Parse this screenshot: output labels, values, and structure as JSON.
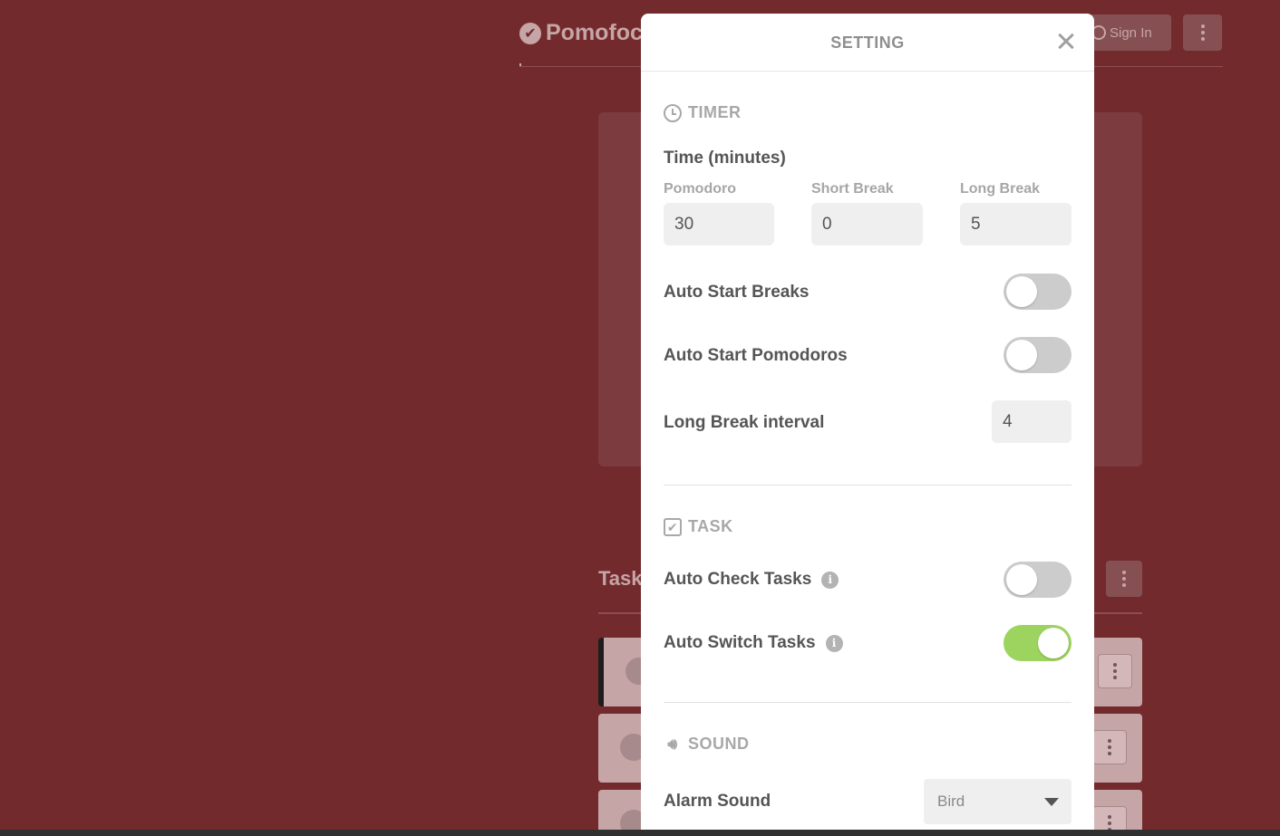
{
  "app": {
    "logo_text": "Pomofoc",
    "signin_label": "Sign In",
    "tasks_title": "Task"
  },
  "modal": {
    "title": "SETTING",
    "timer": {
      "section_label": "TIMER",
      "time_heading": "Time (minutes)",
      "pomodoro_label": "Pomodoro",
      "pomodoro_value": "30",
      "short_break_label": "Short Break",
      "short_break_value": "0",
      "long_break_label": "Long Break",
      "long_break_value": "5",
      "auto_start_breaks_label": "Auto Start Breaks",
      "auto_start_breaks_on": false,
      "auto_start_pomodoros_label": "Auto Start Pomodoros",
      "auto_start_pomodoros_on": false,
      "long_break_interval_label": "Long Break interval",
      "long_break_interval_value": "4"
    },
    "task": {
      "section_label": "TASK",
      "auto_check_label": "Auto Check Tasks",
      "auto_check_on": false,
      "auto_switch_label": "Auto Switch Tasks",
      "auto_switch_on": true
    },
    "sound": {
      "section_label": "SOUND",
      "alarm_label": "Alarm Sound",
      "alarm_value": "Bird"
    }
  },
  "colors": {
    "background": "#722a2d",
    "toggle_on": "#9dd35f",
    "toggle_off": "#cccccc"
  },
  "icons": [
    "check-circle-icon",
    "user-icon",
    "kebab-menu-icon",
    "close-icon",
    "clock-icon",
    "checkbox-icon",
    "info-icon",
    "speaker-icon",
    "caret-down-icon"
  ]
}
